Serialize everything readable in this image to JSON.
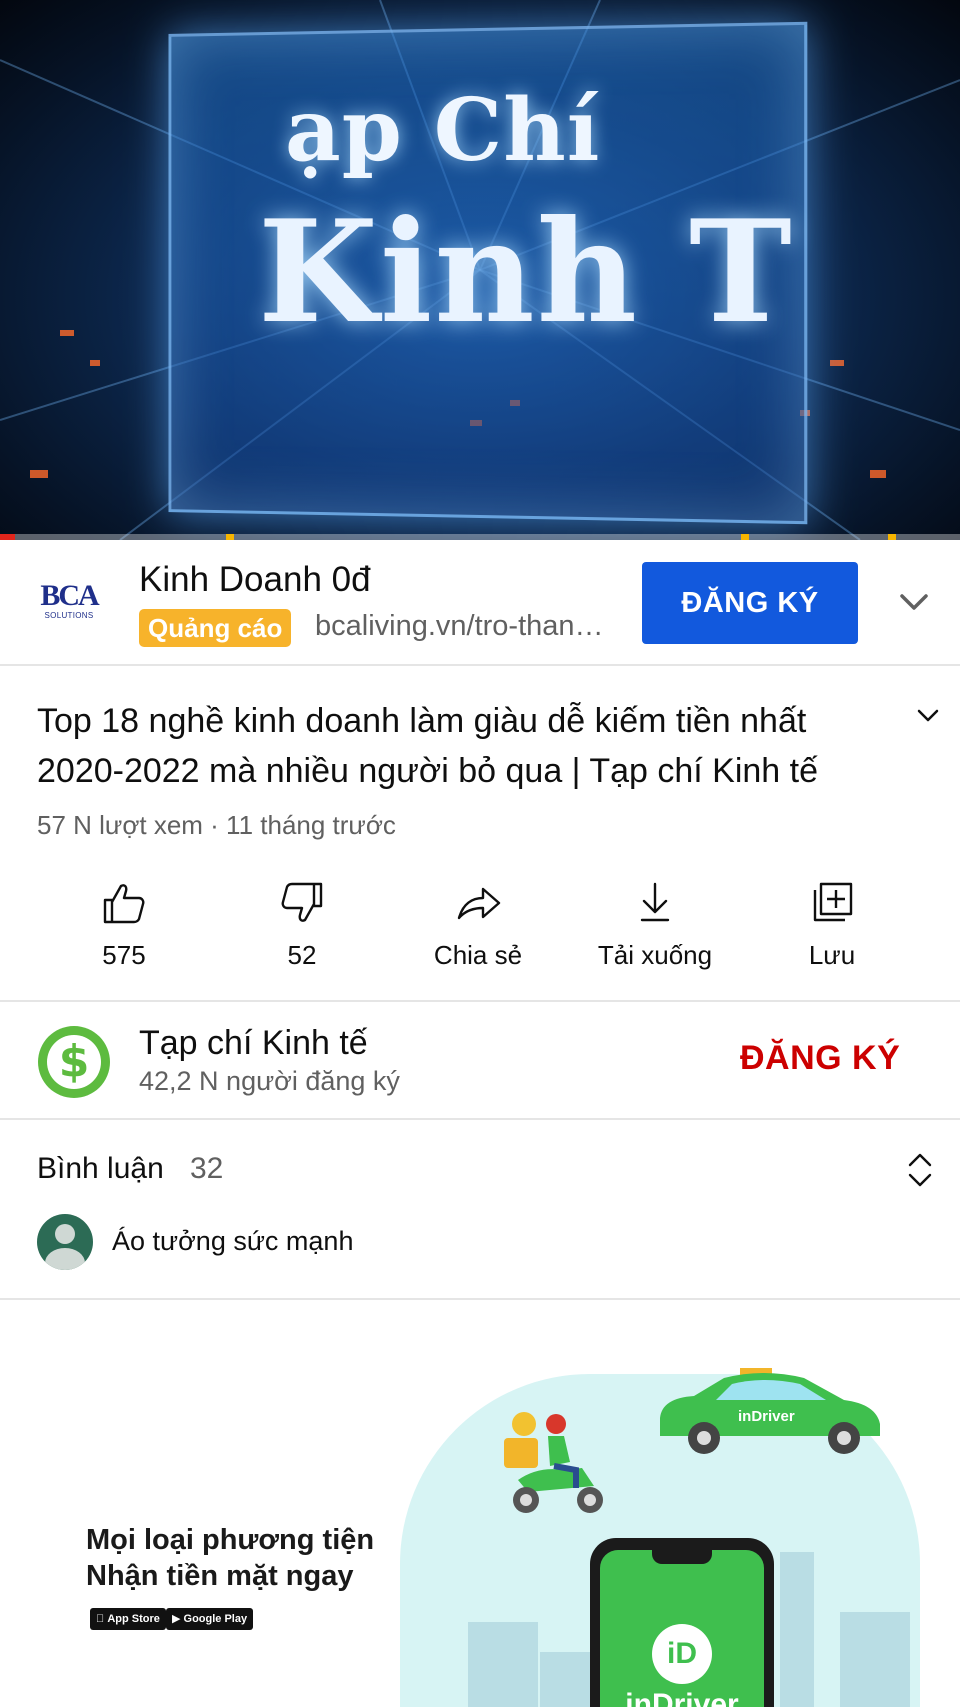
{
  "player": {
    "overlay_line_1": "ạp Chí",
    "overlay_line_2": "Kinh T",
    "progress_fraction": 0.016,
    "ad_marker_fractions": [
      0.235,
      0.772,
      0.925
    ],
    "progress_color": "#e1251b",
    "ad_marker_color": "#f7b500"
  },
  "ad": {
    "logo_text": "BCA",
    "logo_subtext": "SOLUTIONS",
    "title": "Kinh Doanh 0đ",
    "badge": "Quảng cáo",
    "url": "bcaliving.vn/tro-thanh-chu-nha",
    "cta_label": "ĐĂNG KÝ",
    "cta_color": "#1259dd",
    "expand_icon": "chevron-down-icon"
  },
  "video": {
    "title": "Top 18 nghề kinh doanh làm giàu dễ kiếm tiền nhất 2020-2022 mà nhiều người bỏ qua | Tạp chí Kinh tế",
    "meta": "57 N lượt xem · 11 tháng trước",
    "expand_icon": "chevron-down-icon"
  },
  "actions": [
    {
      "name": "like",
      "icon": "thumbs-up-icon",
      "label": "575"
    },
    {
      "name": "dislike",
      "icon": "thumbs-down-icon",
      "label": "52"
    },
    {
      "name": "share",
      "icon": "share-arrow-icon",
      "label": "Chia sẻ"
    },
    {
      "name": "download",
      "icon": "download-icon",
      "label": "Tải xuống"
    },
    {
      "name": "save",
      "icon": "add-to-playlist-icon",
      "label": "Lưu"
    }
  ],
  "channel": {
    "avatar_glyph": "$",
    "name": "Tạp chí Kinh tế",
    "subscribers": "42,2 N người đăng ký",
    "subscribe_label": "ĐĂNG KÝ",
    "subscribe_color": "#cc0000"
  },
  "comments": {
    "title": "Bình luận",
    "count": "32",
    "sort_icon": "unfold-icon",
    "first_comment": "Áo tưởng sức mạnh"
  },
  "banner": {
    "line_1": "Mọi loại phương tiện",
    "line_2": "Nhận tiền mặt ngay",
    "store_1": "App Store",
    "store_2": "Google Play",
    "car_label": "inDriver",
    "phone_logo": "iD",
    "phone_brand": "inDriver",
    "brand_color": "#3fbf4e"
  }
}
